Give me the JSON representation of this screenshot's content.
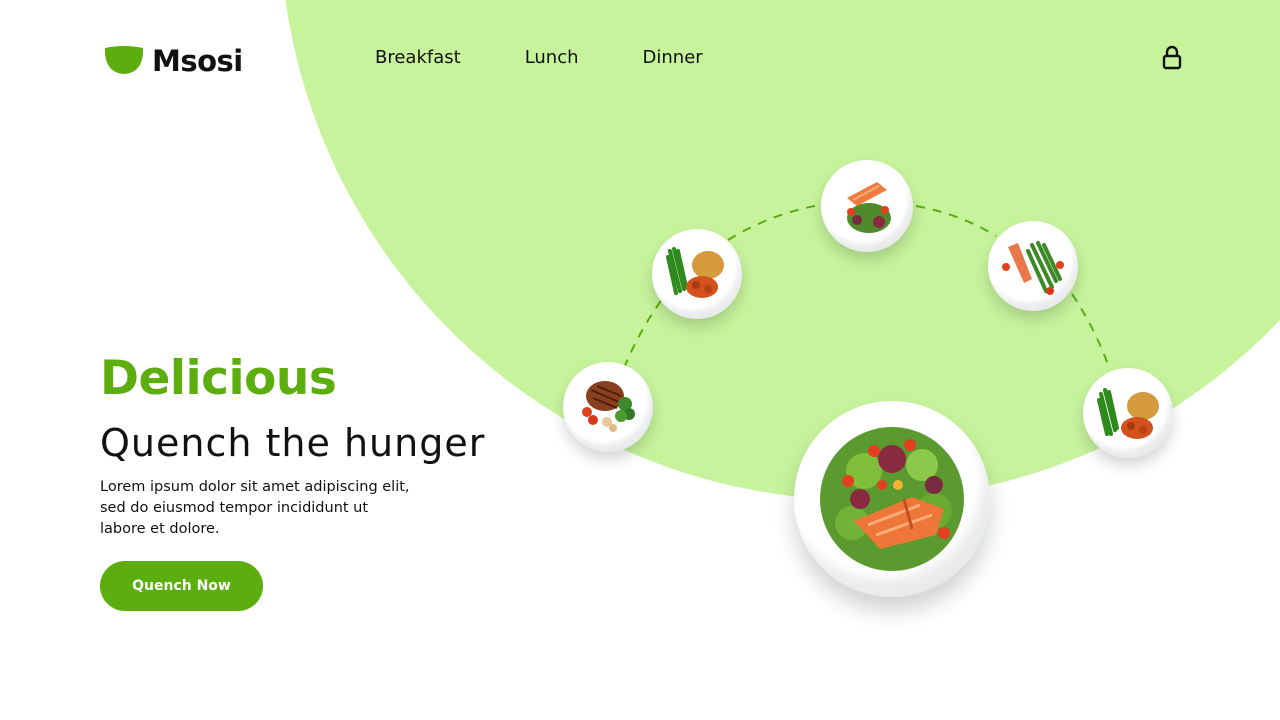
{
  "brand": {
    "name": "Msosi",
    "accent": "#5cad0e",
    "background_shape": "#c7f39c"
  },
  "nav": {
    "items": [
      "Breakfast",
      "Lunch",
      "Dinner"
    ],
    "lock_icon": "lock-icon"
  },
  "hero": {
    "kicker": "Delicious",
    "title": "Quench the hunger",
    "body": "Lorem ipsum dolor sit amet adipiscing elit, sed do eiusmod tempor incididunt ut labore et dolore.",
    "cta_label": "Quench Now"
  },
  "dishes": [
    {
      "id": "steak-plate",
      "icon": "steak-dish-icon"
    },
    {
      "id": "green-beans-rice-plate",
      "icon": "beans-dish-icon"
    },
    {
      "id": "salmon-salad-plate",
      "icon": "salmon-dish-icon"
    },
    {
      "id": "salmon-asparagus-plate",
      "icon": "salmon-asparagus-dish-icon"
    },
    {
      "id": "green-beans-rice-plate-2",
      "icon": "beans-dish-icon"
    },
    {
      "id": "featured-salmon-salad",
      "icon": "featured-salad-icon"
    }
  ]
}
